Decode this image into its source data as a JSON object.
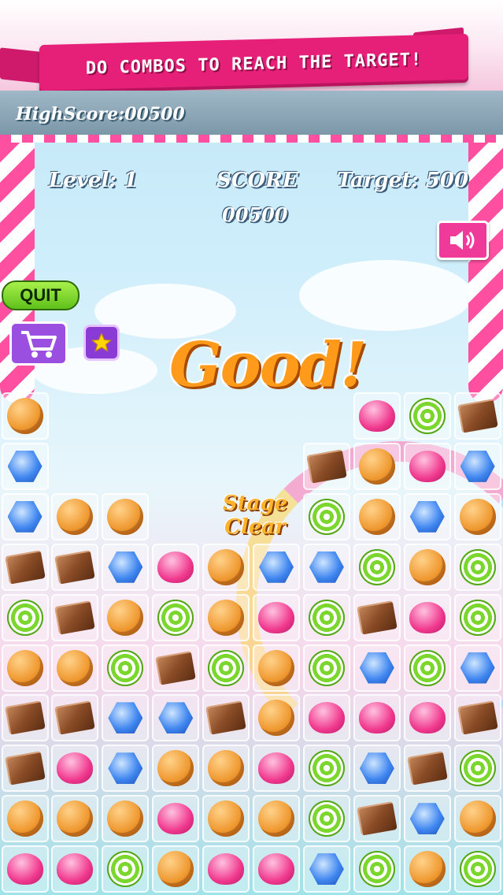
{
  "banner": {
    "text": "DO COMBOS TO REACH THE TARGET!"
  },
  "highscore": {
    "text": "HighScore:00500"
  },
  "hud": {
    "level": "Level: 1",
    "score_label": "SCORE",
    "score_value": "00500",
    "target": "Target: 500"
  },
  "buttons": {
    "quit": "QUIT",
    "sound_icon": "speaker-icon",
    "cart_icon": "cart-icon",
    "star_icon": "star-icon"
  },
  "messages": {
    "good": "Good!",
    "stage_clear": "Stage Clear"
  },
  "colors": {
    "banner": "#e61f79",
    "stripe_pink": "#ff4fa0",
    "quit_green": "#5fc11a",
    "purple": "#9b4fe0"
  },
  "board": {
    "cols": 10,
    "rows": [
      [
        "orange",
        null,
        null,
        null,
        null,
        null,
        null,
        "pink",
        "green",
        "choc"
      ],
      [
        "blue",
        null,
        null,
        null,
        null,
        null,
        "choc",
        "orange",
        "pink",
        "blue"
      ],
      [
        "blue",
        "orange",
        "orange",
        null,
        null,
        null,
        "green",
        "orange",
        "blue",
        "orange"
      ],
      [
        "choc",
        "choc",
        "blue",
        "pink",
        "orange",
        "blue",
        "blue",
        "green",
        "orange",
        "green"
      ],
      [
        "green",
        "choc",
        "orange",
        "green",
        "orange",
        "pink",
        "green",
        "choc",
        "pink",
        "green"
      ],
      [
        "orange",
        "orange",
        "green",
        "choc",
        "green",
        "orange",
        "green",
        "blue",
        "green",
        "blue"
      ],
      [
        "choc",
        "choc",
        "blue",
        "blue",
        "choc",
        "orange",
        "pink",
        "pink",
        "pink",
        "choc"
      ],
      [
        "choc",
        "pink",
        "blue",
        "orange",
        "orange",
        "pink",
        "green",
        "blue",
        "choc",
        "green"
      ],
      [
        "orange",
        "orange",
        "orange",
        "pink",
        "orange",
        "orange",
        "green",
        "choc",
        "blue",
        "orange"
      ],
      [
        "pink",
        "pink",
        "green",
        "orange",
        "pink",
        "pink",
        "blue",
        "green",
        "orange",
        "green"
      ]
    ]
  }
}
